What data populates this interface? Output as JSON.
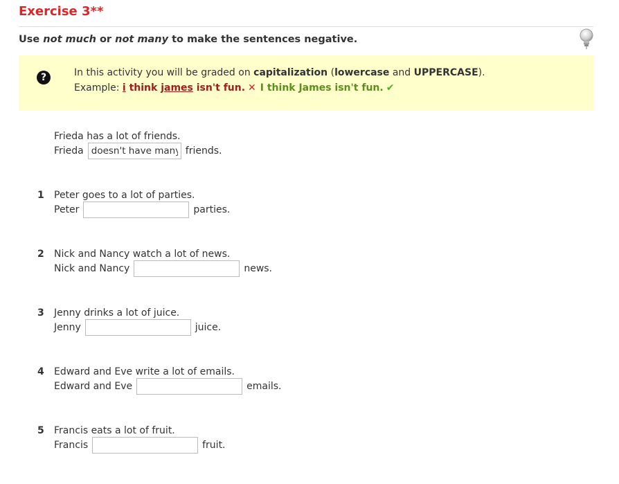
{
  "exercise": {
    "title": "Exercise 3**",
    "instructions": {
      "pre": "Use ",
      "opt1": "not much",
      "mid": " or ",
      "opt2": "not many",
      "post": " to make the sentences negative."
    }
  },
  "notice": {
    "line1_pre": "In this activity you will be graded on ",
    "line1_b1": "capitalization",
    "line1_p1": " (",
    "line1_b2": "lowercase",
    "line1_p2": " and ",
    "line1_b3": "UPPERCASE",
    "line1_p3": ").",
    "example_label": "Example: ",
    "wrong_a": "i",
    "wrong_b": " think ",
    "wrong_c": "james",
    "wrong_d": " isn't fun.",
    "cross": "✕",
    "right": "I think James isn't fun.",
    "check": "✔"
  },
  "example": {
    "prompt": "Frieda has a lot of friends.",
    "before": "Frieda",
    "value": "doesn't have many",
    "after": "friends."
  },
  "items": [
    {
      "num": "1",
      "prompt": "Peter goes to a lot of parties.",
      "before": "Peter",
      "value": "",
      "after": "parties."
    },
    {
      "num": "2",
      "prompt": "Nick and Nancy watch a lot of news.",
      "before": "Nick and Nancy",
      "value": "",
      "after": "news."
    },
    {
      "num": "3",
      "prompt": "Jenny drinks a lot of juice.",
      "before": "Jenny",
      "value": "",
      "after": "juice."
    },
    {
      "num": "4",
      "prompt": "Edward and Eve write a lot of emails.",
      "before": "Edward and Eve",
      "value": "",
      "after": "emails."
    },
    {
      "num": "5",
      "prompt": "Francis eats a lot of fruit.",
      "before": "Francis",
      "value": "",
      "after": "fruit."
    }
  ],
  "icons": {
    "hint": "lightbulb-icon",
    "help": "question-circle-icon"
  },
  "colors": {
    "title": "#d9262b",
    "notice_bg": "#ffffcc",
    "wrong": "#a51c1c",
    "right": "#5b8f1e"
  }
}
